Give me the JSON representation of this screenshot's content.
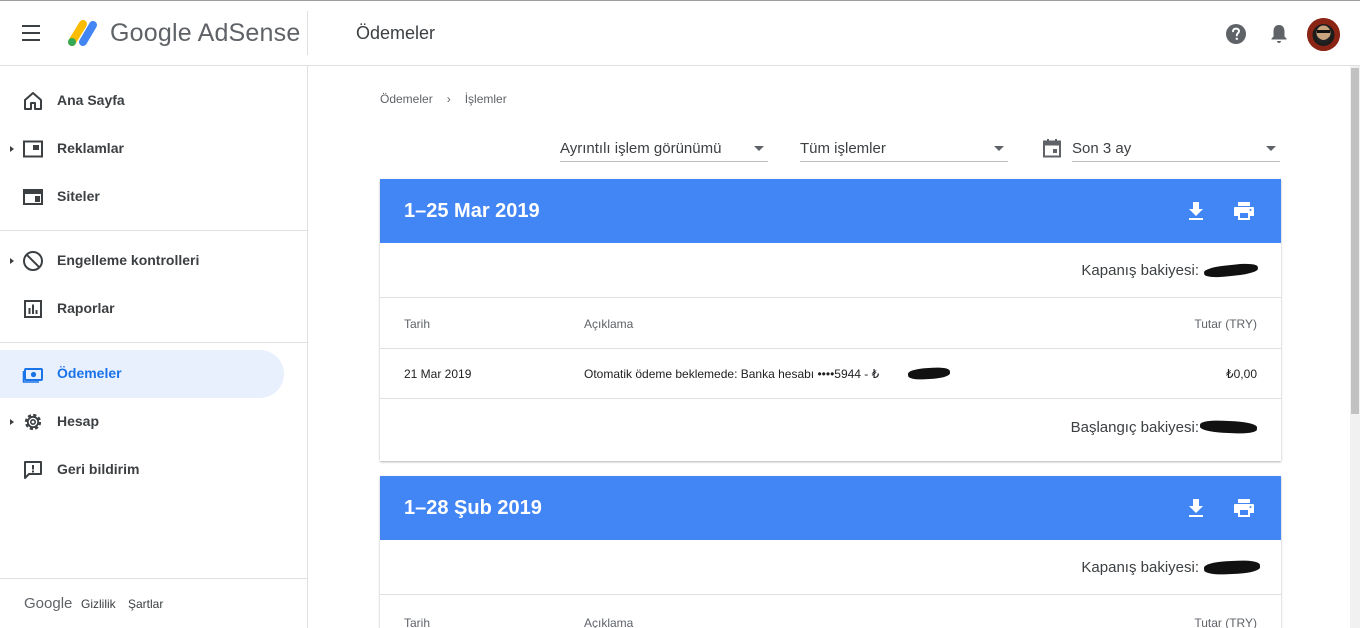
{
  "header": {
    "brand": "Google AdSense",
    "page_title": "Ödemeler"
  },
  "sidebar": {
    "items": [
      {
        "label": "Ana Sayfa",
        "icon": "home-icon"
      },
      {
        "label": "Reklamlar",
        "icon": "ads-icon"
      },
      {
        "label": "Siteler",
        "icon": "sites-icon"
      },
      {
        "label": "Engelleme kontrolleri",
        "icon": "block-icon"
      },
      {
        "label": "Raporlar",
        "icon": "reports-icon"
      },
      {
        "label": "Ödemeler",
        "icon": "payments-icon",
        "active": true
      },
      {
        "label": "Hesap",
        "icon": "settings-gear-icon"
      },
      {
        "label": "Geri bildirim",
        "icon": "feedback-icon"
      }
    ],
    "footer": {
      "google": "Google",
      "privacy": "Gizlilik",
      "terms": "Şartlar"
    }
  },
  "breadcrumb": {
    "parent": "Ödemeler",
    "separator": "›",
    "current": "İşlemler"
  },
  "filters": {
    "view": "Ayrıntılı işlem görünümü",
    "type": "Tüm işlemler",
    "range": "Son 3 ay"
  },
  "statements": [
    {
      "period": "1–25 Mar 2019",
      "closing_label": "Kapanış bakiyesi:",
      "columns": {
        "date": "Tarih",
        "description": "Açıklama",
        "amount": "Tutar (TRY)"
      },
      "transactions": [
        {
          "date": "21 Mar 2019",
          "description": "Otomatik ödeme beklemede: Banka hesabı ••••5944 - ₺",
          "amount": "₺0,00"
        }
      ],
      "starting_label": "Başlangıç bakiyesi:"
    },
    {
      "period": "1–28 Şub 2019",
      "closing_label": "Kapanış bakiyesi:",
      "columns": {
        "date": "Tarih",
        "description": "Açıklama",
        "amount": "Tutar (TRY)"
      }
    }
  ],
  "colors": {
    "accent": "#1a73e8",
    "card_header": "#4285f4",
    "active_nav_bg": "#e8f0fe"
  }
}
